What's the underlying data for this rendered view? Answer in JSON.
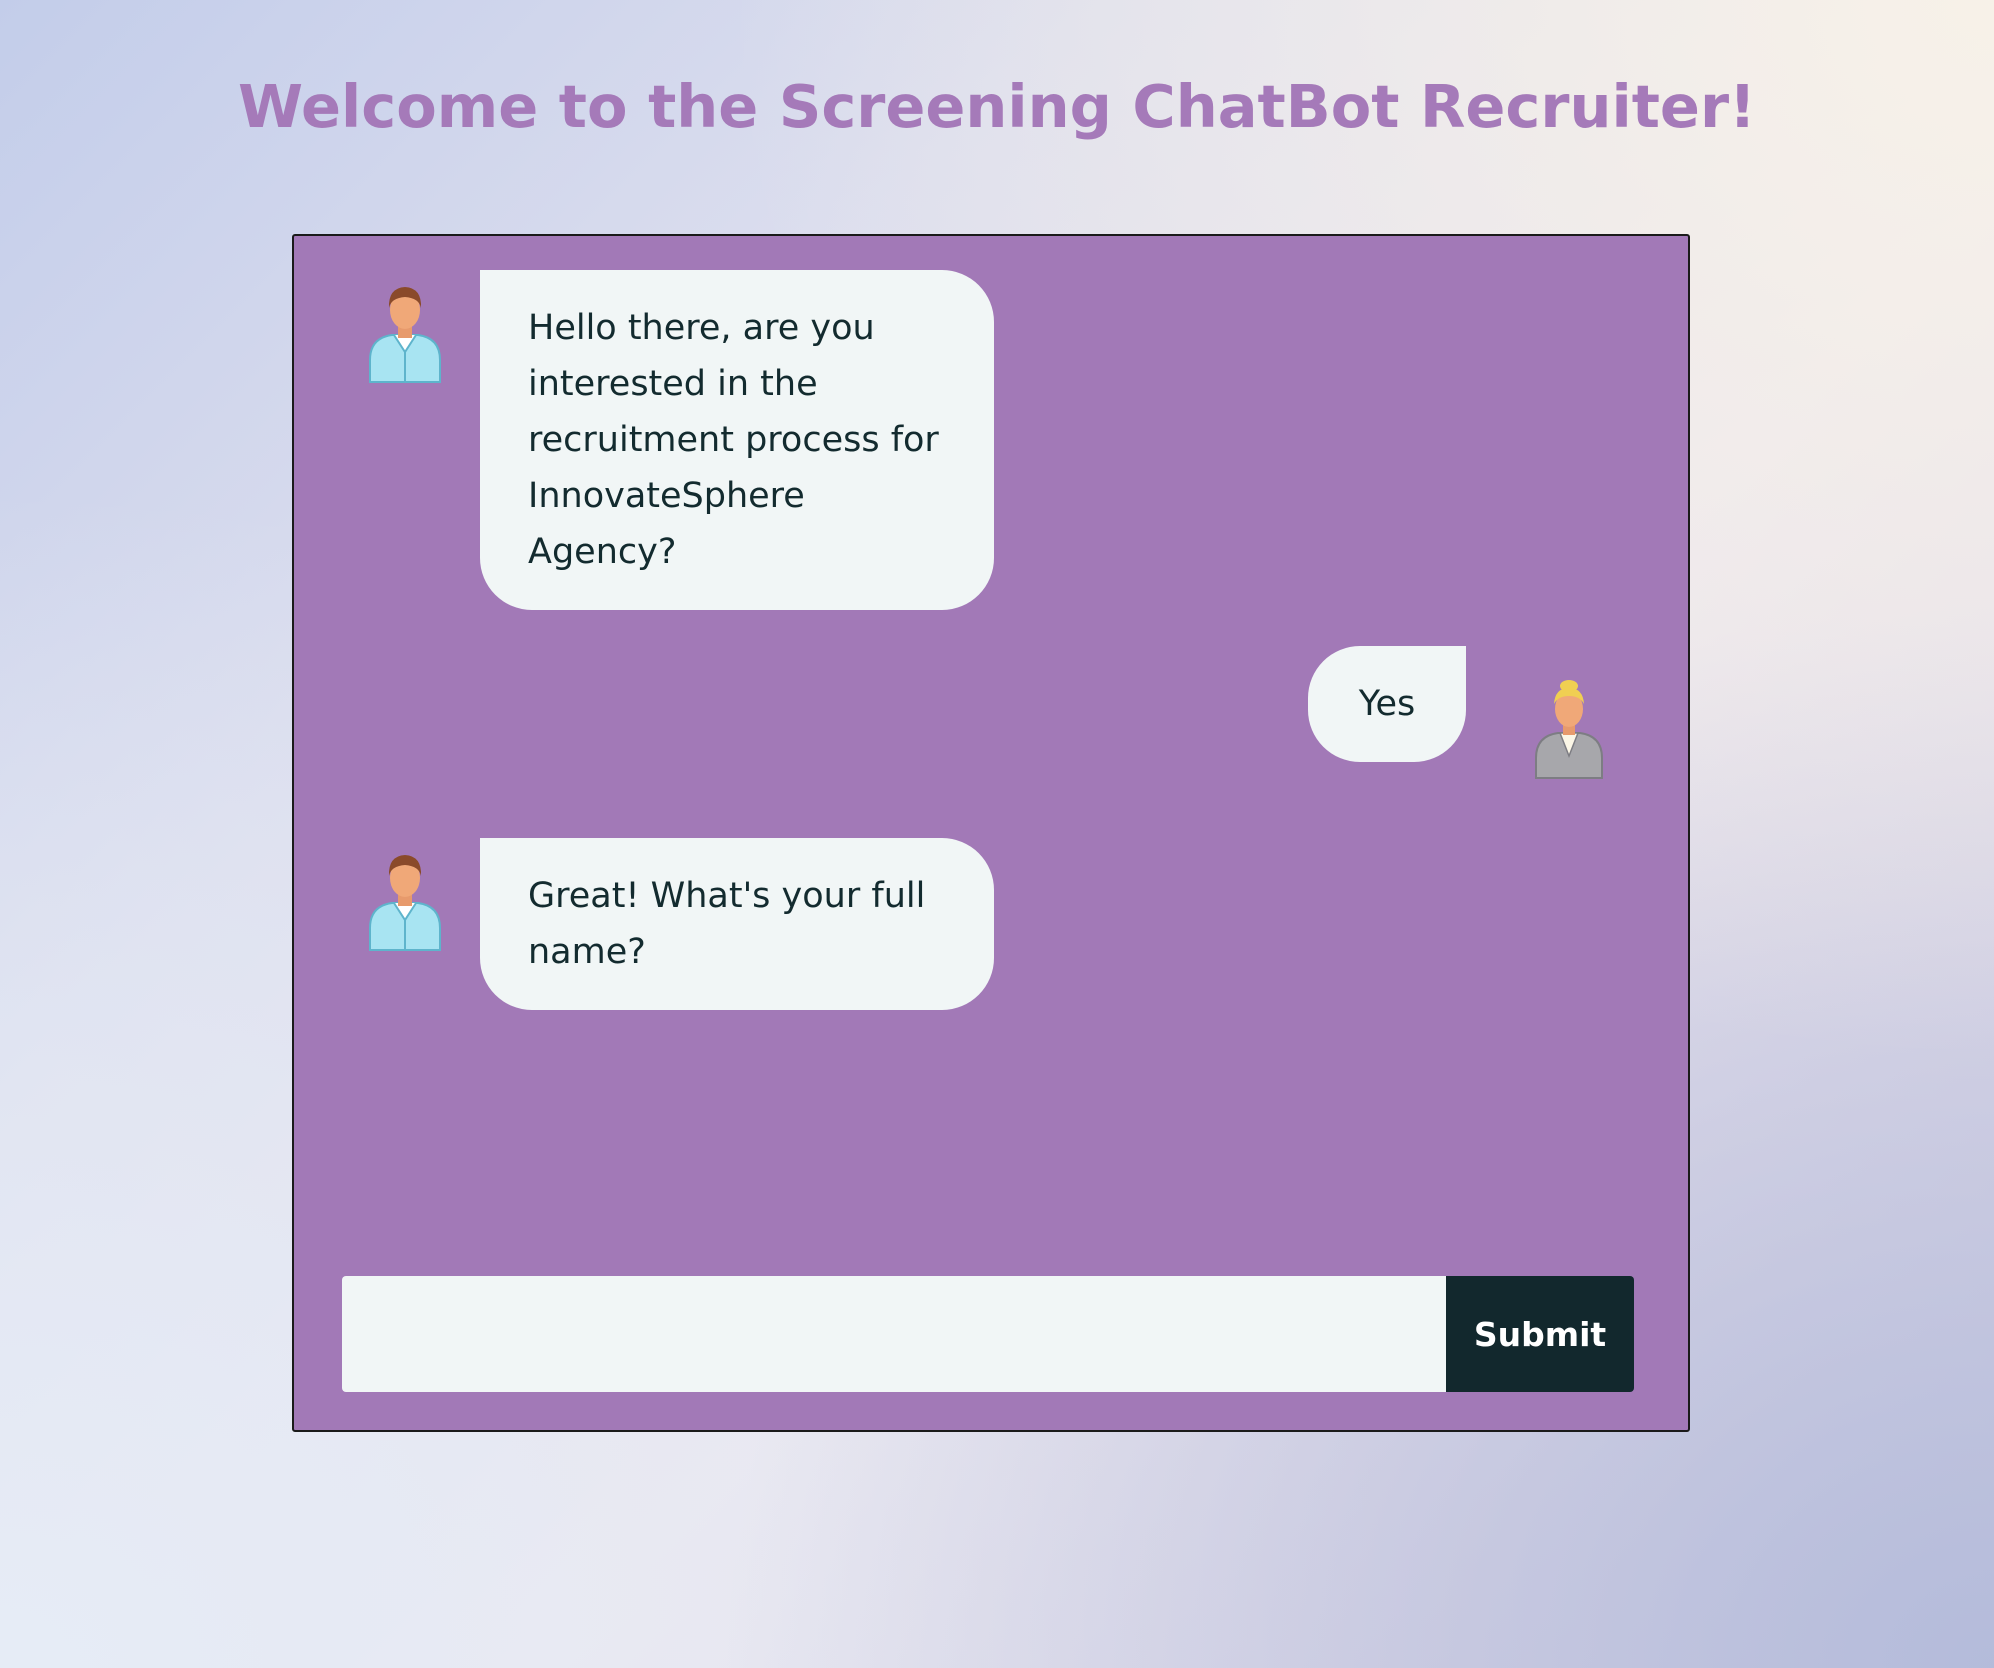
{
  "page": {
    "title": "Welcome to the Screening ChatBot Recruiter!"
  },
  "messages": [
    {
      "sender": "bot",
      "avatar_icon": "male-recruiter-avatar-icon",
      "text": "Hello there, are you interested in the recruitment process for InnovateSphere Agency?"
    },
    {
      "sender": "user",
      "avatar_icon": "female-candidate-avatar-icon",
      "text": "Yes"
    },
    {
      "sender": "bot",
      "avatar_icon": "male-recruiter-avatar-icon",
      "text": "Great! What's your full name?"
    }
  ],
  "input": {
    "value": "",
    "placeholder": ""
  },
  "submit": {
    "label": "Submit"
  },
  "colors": {
    "title": "#a57ab9",
    "chat_background": "#a279b7",
    "bubble": "#f1f6f6",
    "text": "#132b2f",
    "button": "#12282d"
  }
}
